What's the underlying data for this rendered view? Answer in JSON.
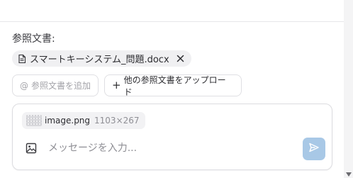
{
  "references": {
    "label": "参照文書:",
    "documents": [
      {
        "name": "スマートキーシステム_問題.docx",
        "icon": "document-icon",
        "remove_icon": "close-icon"
      }
    ]
  },
  "actions": {
    "add_label": "参照文書を追加",
    "add_icon": "at-icon",
    "upload_label": "他の参照文書をアップロード",
    "upload_icon": "plus-icon"
  },
  "composer": {
    "attachment": {
      "name": "image.png",
      "size": "1103×267",
      "icon": "image-thumbnail"
    },
    "image_icon": "image-icon",
    "placeholder": "メッセージを入力...",
    "send_icon": "send-icon",
    "send_color": "#a8c8e6"
  }
}
